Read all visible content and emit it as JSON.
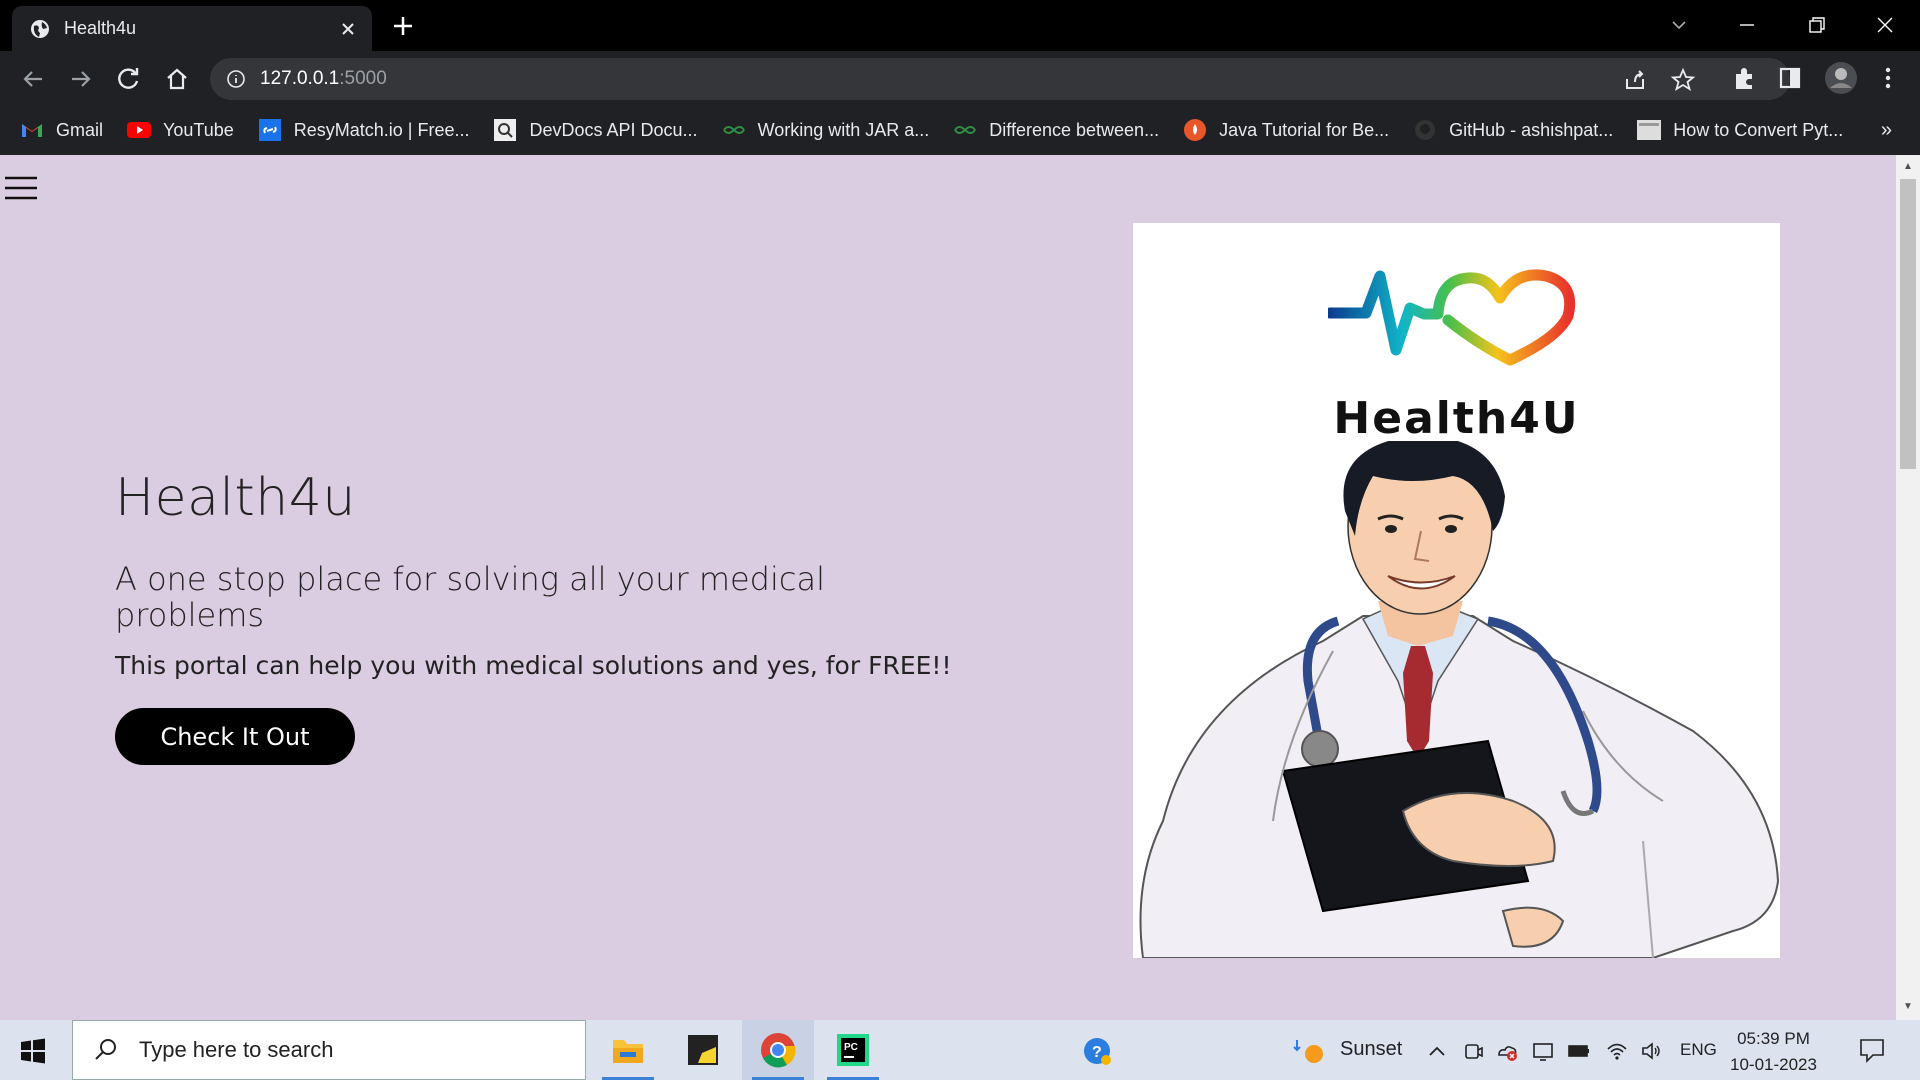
{
  "browser": {
    "tab_title": "Health4u",
    "url_host": "127.0.0.1",
    "url_port": ":5000",
    "bookmarks": [
      {
        "label": "Gmail",
        "icon": "gmail-icon"
      },
      {
        "label": "YouTube",
        "icon": "youtube-icon"
      },
      {
        "label": "ResyMatch.io | Free...",
        "icon": "resymatch-icon"
      },
      {
        "label": "DevDocs API Docu...",
        "icon": "devdocs-icon"
      },
      {
        "label": "Working with JAR a...",
        "icon": "geeks-icon"
      },
      {
        "label": "Difference between...",
        "icon": "geeks-icon"
      },
      {
        "label": "Java Tutorial for Be...",
        "icon": "guru99-icon"
      },
      {
        "label": "GitHub - ashishpat...",
        "icon": "github-icon"
      },
      {
        "label": "How to Convert Pyt...",
        "icon": "page-icon"
      }
    ],
    "more_bookmarks": "»"
  },
  "page": {
    "title": "Health4u",
    "subtitle": "A one stop place for solving all your medical problems",
    "description": "This portal can help you with medical solutions and yes, for FREE!!",
    "cta_label": "Check It Out",
    "image_brand": "Health4U"
  },
  "taskbar": {
    "search_placeholder": "Type here to search",
    "weather": "Sunset",
    "language": "ENG",
    "time": "05:39 PM",
    "date": "10-01-2023"
  },
  "colors": {
    "page_bg": "#dbcde1",
    "cta_bg": "#000000",
    "browser_dark": "#202124"
  }
}
